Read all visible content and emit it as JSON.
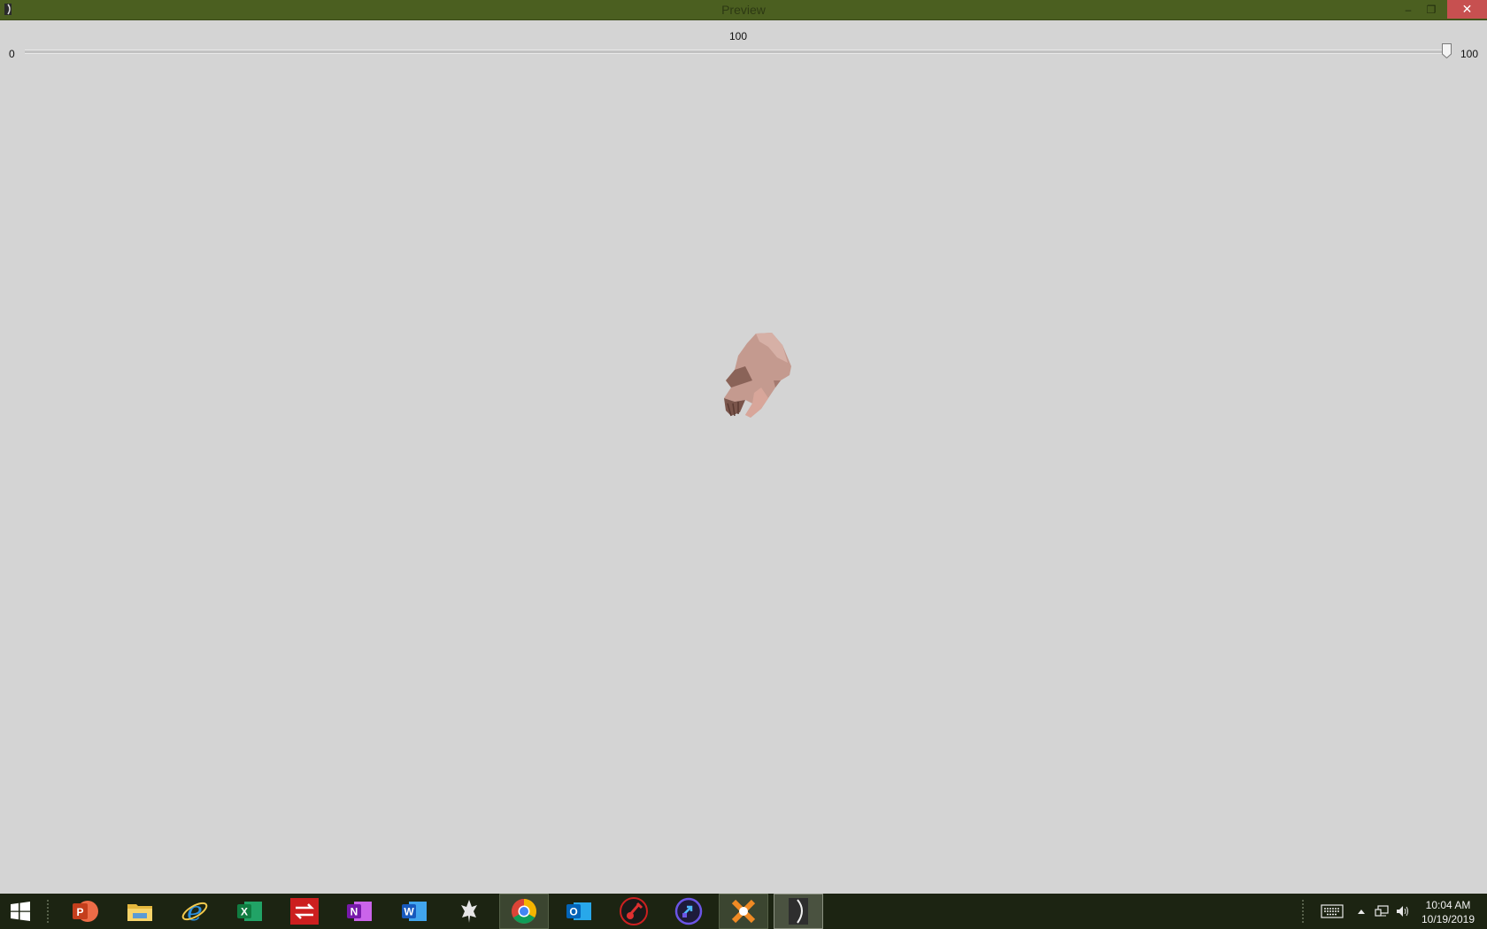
{
  "window": {
    "title": "Preview",
    "minimize_glyph": "–",
    "restore_glyph": "❐",
    "close_glyph": "✕"
  },
  "slider": {
    "value": "100",
    "min": "0",
    "max": "100",
    "level_fraction": 1.0
  },
  "viewport": {
    "background": "#d4d4d4",
    "model": "3d-mesh-preview"
  },
  "taskbar": {
    "apps": [
      {
        "name": "powerpoint",
        "icon": "powerpoint-icon",
        "color": "#d04423",
        "letter": "P"
      },
      {
        "name": "file-explorer",
        "icon": "folder-icon",
        "color": "#f2c94c"
      },
      {
        "name": "internet-explorer",
        "icon": "internet-explorer-icon",
        "color": "#1e88e5",
        "letter": "e"
      },
      {
        "name": "excel",
        "icon": "excel-icon",
        "color": "#1e7145",
        "letter": "X"
      },
      {
        "name": "transfer-app",
        "icon": "transfer-arrows-icon",
        "color": "#d01f1f"
      },
      {
        "name": "onenote",
        "icon": "onenote-icon",
        "color": "#7b3ea0",
        "letter": "N"
      },
      {
        "name": "word",
        "icon": "word-icon",
        "color": "#2b5797",
        "letter": "W"
      },
      {
        "name": "skyrim",
        "icon": "skyrim-icon",
        "color": "#e8e8e8"
      },
      {
        "name": "chrome",
        "icon": "chrome-icon",
        "color": "#4285f4"
      },
      {
        "name": "outlook",
        "icon": "outlook-icon",
        "color": "#0072c6",
        "letter": "O"
      },
      {
        "name": "guitar-app",
        "icon": "guitar-icon",
        "color": "#cc2020"
      },
      {
        "name": "shape-app",
        "icon": "shape-arrow-icon",
        "color": "#5a3fc8"
      },
      {
        "name": "blender",
        "icon": "blender-icon",
        "color": "#f08020"
      },
      {
        "name": "preview-app",
        "icon": "preview-app-icon",
        "color": "#444444"
      }
    ],
    "clock": {
      "time": "10:04 AM",
      "date": "10/19/2019"
    }
  }
}
